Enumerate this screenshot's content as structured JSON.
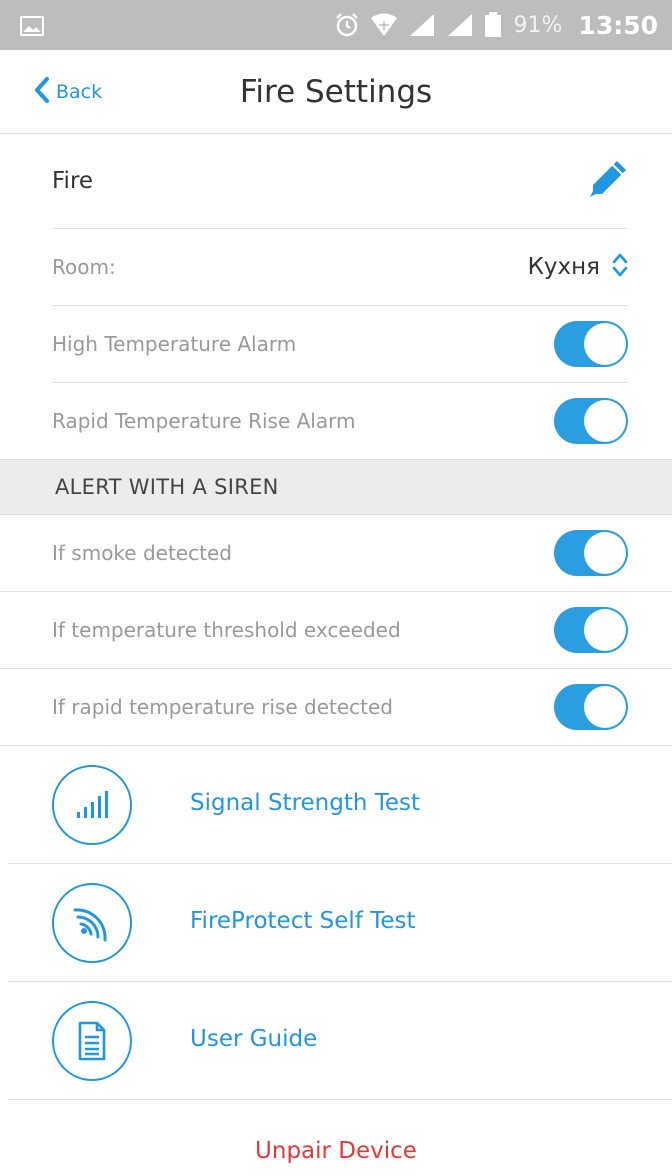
{
  "status_bar": {
    "battery": "91%",
    "time": "13:50",
    "icons": [
      "image-icon",
      "alarm-clock-icon",
      "wifi-icon",
      "signal-icon",
      "signal-icon",
      "battery-icon"
    ]
  },
  "nav": {
    "back_label": "Back",
    "title": "Fire Settings"
  },
  "device": {
    "name": "Fire",
    "room_label": "Room:",
    "room_value": "Кухня"
  },
  "toggles": {
    "high_temp_label": "High Temperature Alarm",
    "high_temp_on": true,
    "rapid_rise_label": "Rapid Temperature Rise Alarm",
    "rapid_rise_on": true
  },
  "siren_section": {
    "header": "ALERT WITH A SIREN",
    "smoke_label": "If smoke detected",
    "smoke_on": true,
    "threshold_label": "If temperature threshold exceeded",
    "threshold_on": true,
    "rise_label": "If rapid temperature rise detected",
    "rise_on": true
  },
  "actions": {
    "signal_test": "Signal Strength Test",
    "self_test": "FireProtect Self Test",
    "user_guide": "User Guide"
  },
  "unpair_label": "Unpair Device",
  "colors": {
    "accent": "#2196e3",
    "toggle_on": "#2a9ee0",
    "danger": "#e53935",
    "status_bar": "#bdbdbd"
  }
}
